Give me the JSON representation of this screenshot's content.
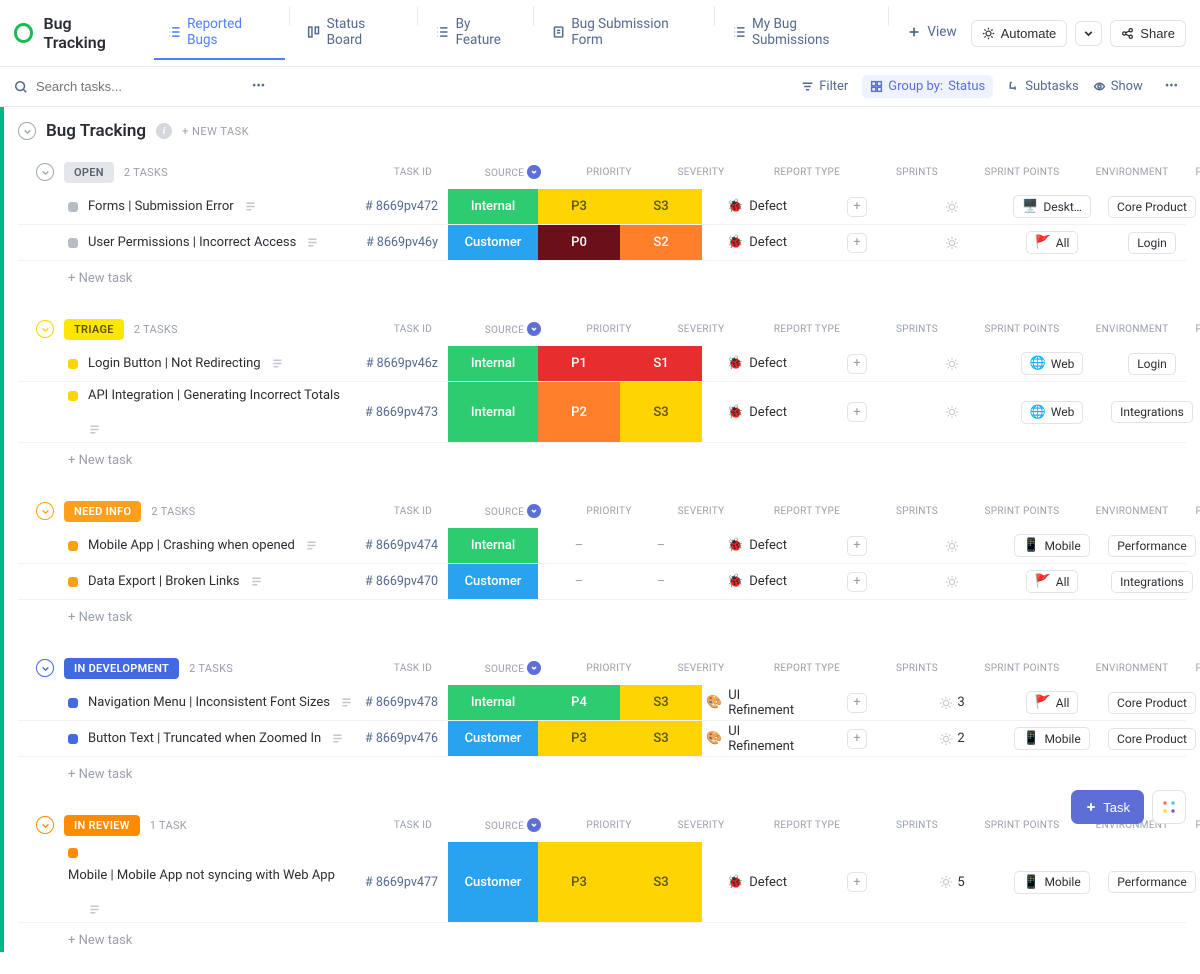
{
  "header": {
    "title": "Bug Tracking",
    "tabs": [
      "Reported Bugs",
      "Status Board",
      "By Feature",
      "Bug Submission Form",
      "My Bug Submissions"
    ],
    "addView": "View",
    "automate": "Automate",
    "share": "Share"
  },
  "toolbar": {
    "searchPlaceholder": "Search tasks...",
    "filter": "Filter",
    "groupByLabel": "Group by:",
    "groupByValue": "Status",
    "subtasks": "Subtasks",
    "show": "Show"
  },
  "main": {
    "title": "Bug Tracking",
    "newTask": "+ NEW TASK"
  },
  "columns": [
    "TASK ID",
    "SOURCE",
    "PRIORITY",
    "SEVERITY",
    "REPORT TYPE",
    "SPRINTS",
    "SPRINT POINTS",
    "ENVIRONMENT",
    "PRODUCT FEATURE"
  ],
  "newTaskRow": "+ New task",
  "groups": [
    {
      "key": "open",
      "label": "OPEN",
      "count": "2 TASKS",
      "tagClass": "open",
      "sqColor": "#b8bcc4",
      "circleColor": "#9da7b3",
      "rows": [
        {
          "name": "Forms | Submission Error",
          "id": "# 8669pv472",
          "source": "Internal",
          "srcClass": "internal",
          "pri": "P3",
          "priClass": "p3",
          "sev": "S3",
          "sevClass": "s3",
          "rtype": "Defect",
          "ricon": "🐞",
          "points": "",
          "env": "Deskt…",
          "envIcon": "🖥️",
          "feat": "Core Product"
        },
        {
          "name": "User Permissions | Incorrect Access",
          "id": "# 8669pv46y",
          "source": "Customer",
          "srcClass": "customer",
          "pri": "P0",
          "priClass": "p0",
          "sev": "S2",
          "sevClass": "s2",
          "rtype": "Defect",
          "ricon": "🐞",
          "points": "",
          "env": "All",
          "envIcon": "🚩",
          "feat": "Login"
        }
      ]
    },
    {
      "key": "triage",
      "label": "TRIAGE",
      "count": "2 TASKS",
      "tagClass": "triage",
      "sqColor": "#ffd400",
      "circleColor": "#ffd400",
      "rows": [
        {
          "name": "Login Button | Not Redirecting",
          "id": "# 8669pv46z",
          "source": "Internal",
          "srcClass": "internal",
          "pri": "P1",
          "priClass": "p1",
          "sev": "S1",
          "sevClass": "s1",
          "rtype": "Defect",
          "ricon": "🐞",
          "points": "",
          "env": "Web",
          "envIcon": "🌐",
          "feat": "Login"
        },
        {
          "name": "API Integration | Generating Incorrect Totals",
          "id": "# 8669pv473",
          "source": "Internal",
          "srcClass": "internal",
          "pri": "P2",
          "priClass": "p2",
          "sev": "S3",
          "sevClass": "s3",
          "rtype": "Defect",
          "ricon": "🐞",
          "points": "",
          "env": "Web",
          "envIcon": "🌐",
          "feat": "Integrations",
          "multiline": true
        }
      ]
    },
    {
      "key": "needinfo",
      "label": "NEED INFO",
      "count": "2 TASKS",
      "tagClass": "needinfo",
      "sqColor": "#ff9f1a",
      "circleColor": "#ff9f1a",
      "rows": [
        {
          "name": "Mobile App | Crashing when opened",
          "id": "# 8669pv474",
          "source": "Internal",
          "srcClass": "internal",
          "pri": "–",
          "priClass": "empty",
          "sev": "–",
          "sevClass": "empty",
          "rtype": "Defect",
          "ricon": "🐞",
          "points": "",
          "env": "Mobile",
          "envIcon": "📱",
          "feat": "Performance"
        },
        {
          "name": "Data Export | Broken Links",
          "id": "# 8669pv470",
          "source": "Customer",
          "srcClass": "customer",
          "pri": "–",
          "priClass": "empty",
          "sev": "–",
          "sevClass": "empty",
          "rtype": "Defect",
          "ricon": "🐞",
          "points": "",
          "env": "All",
          "envIcon": "🚩",
          "feat": "Integrations"
        }
      ]
    },
    {
      "key": "indev",
      "label": "IN DEVELOPMENT",
      "count": "2 TASKS",
      "tagClass": "indev",
      "sqColor": "#4169e1",
      "circleColor": "#4169e1",
      "rows": [
        {
          "name": "Navigation Menu | Inconsistent Font Sizes",
          "id": "# 8669pv478",
          "source": "Internal",
          "srcClass": "internal",
          "pri": "P4",
          "priClass": "p4",
          "sev": "S3",
          "sevClass": "s3",
          "rtype": "UI Refinement",
          "ricon": "🎨",
          "points": "3",
          "env": "All",
          "envIcon": "🚩",
          "feat": "Core Product"
        },
        {
          "name": "Button Text | Truncated when Zoomed In",
          "id": "# 8669pv476",
          "source": "Customer",
          "srcClass": "customer",
          "pri": "P3",
          "priClass": "p3",
          "sev": "S3",
          "sevClass": "s3",
          "rtype": "UI Refinement",
          "ricon": "🎨",
          "points": "2",
          "env": "Mobile",
          "envIcon": "📱",
          "feat": "Core Product"
        }
      ]
    },
    {
      "key": "inrev",
      "label": "IN REVIEW",
      "count": "1 TASK",
      "tagClass": "inrev",
      "sqColor": "#ff8c00",
      "circleColor": "#ff8c00",
      "rows": [
        {
          "name": "Mobile | Mobile App not syncing with Web App",
          "id": "# 8669pv477",
          "source": "Customer",
          "srcClass": "customer",
          "pri": "P3",
          "priClass": "p3",
          "sev": "S3",
          "sevClass": "s3",
          "rtype": "Defect",
          "ricon": "🐞",
          "points": "5",
          "env": "Mobile",
          "envIcon": "📱",
          "feat": "Performance",
          "multiline": true
        }
      ]
    }
  ],
  "fab": {
    "task": "Task"
  }
}
